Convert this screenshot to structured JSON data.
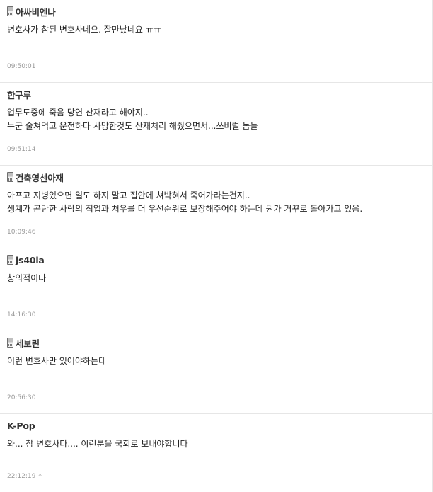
{
  "comments": [
    {
      "nick": "아싸비엔나",
      "mobile": true,
      "icon": "mobile-phone-icon",
      "lines": [
        "변호사가 참된 변호사네요. 잘만났네요 ㅠㅠ"
      ],
      "time": "09:50:01"
    },
    {
      "nick": "한구루",
      "mobile": false,
      "lines": [
        "업무도중에 죽음 당연 산재라고 해야지..",
        "누군 술쳐먹고 운전하다 사망한것도 산재처리 해줬으면서...쓰버럴 놈들"
      ],
      "time": "09:51:14"
    },
    {
      "nick": "건축영선아재",
      "mobile": true,
      "icon": "mobile-phone-icon",
      "lines": [
        "아프고 지병있으면 일도 하지 말고 집안에 쳐박혀서 죽어가라는건지..",
        "생계가 곤란한 사람의 직업과 처우를 더 우선순위로 보장해주어야 하는데 뭔가 거꾸로 돌아가고 있음."
      ],
      "time": "10:09:46"
    },
    {
      "nick": "js40la",
      "mobile": true,
      "icon": "mobile-phone-icon",
      "lines": [
        "창의적이다"
      ],
      "time": "14:16:30"
    },
    {
      "nick": "세보린",
      "mobile": true,
      "icon": "mobile-phone-icon",
      "lines": [
        "이런 변호사만 있어야하는데"
      ],
      "time": "20:56:30"
    },
    {
      "nick": "K-Pop",
      "mobile": false,
      "lines": [
        "와... 참 변호사다.... 이런분을 국회로 보내야합니다"
      ],
      "time": "22:12:19",
      "time_suffix": "*"
    }
  ]
}
